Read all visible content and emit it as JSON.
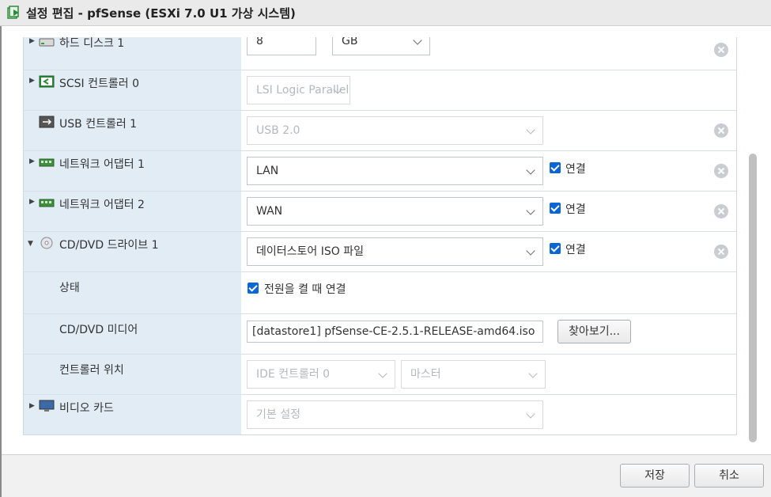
{
  "window": {
    "title": "설정 편집 - pfSense (ESXi 7.0 U1 가상 시스템)",
    "icon": "vm-icon"
  },
  "rows": {
    "harddisk": {
      "label": "하드 디스크 1",
      "size_value": "8",
      "size_unit": "GB"
    },
    "scsi": {
      "label": "SCSI 컨트롤러 0",
      "type": "LSI Logic Parallel"
    },
    "usb": {
      "label": "USB 컨트롤러 1",
      "type": "USB 2.0"
    },
    "nic1": {
      "label": "네트워크 어댑터 1",
      "network": "LAN",
      "connect_label": "연결",
      "connected": true
    },
    "nic2": {
      "label": "네트워크 어댑터 2",
      "network": "WAN",
      "connect_label": "연결",
      "connected": true
    },
    "cddvd": {
      "label": "CD/DVD 드라이브 1",
      "source": "데이터스토어 ISO 파일",
      "connect_label": "연결",
      "connected": true
    },
    "status": {
      "label": "상태",
      "power_on_connect_label": "전원을 켤 때 연결",
      "power_on_connect": true
    },
    "media": {
      "label": "CD/DVD 미디어",
      "path": "[datastore1] pfSense-CE-2.5.1-RELEASE-amd64.iso",
      "browse_label": "찾아보기..."
    },
    "controller_location": {
      "label": "컨트롤러 위치",
      "controller": "IDE 컨트롤러 0",
      "position": "마스터"
    },
    "video": {
      "label": "비디오 카드",
      "setting": "기본 설정"
    }
  },
  "footer": {
    "save_label": "저장",
    "cancel_label": "취소"
  },
  "colors": {
    "label_bg": "#e1ecf4",
    "checkbox": "#0a66d6",
    "titlebar_bg": "#eaeaea"
  }
}
